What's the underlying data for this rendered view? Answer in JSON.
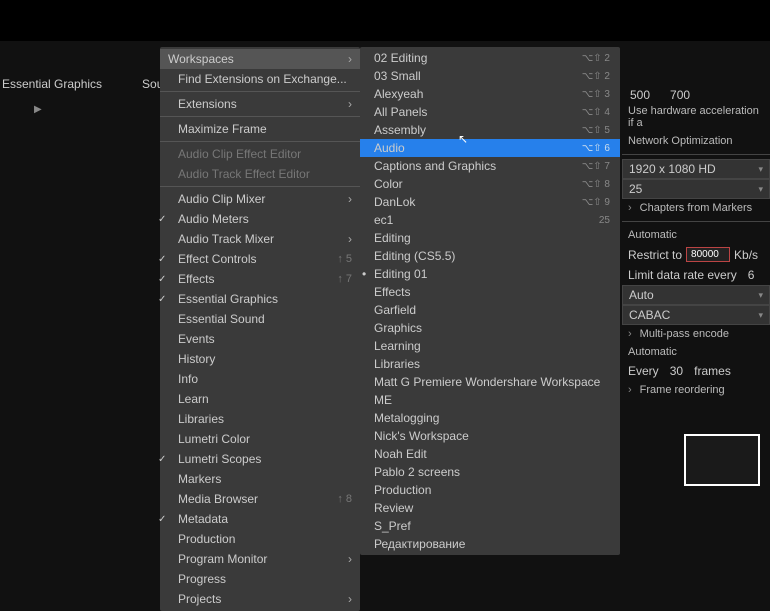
{
  "tabs": {
    "essential_graphics": "Essential Graphics",
    "source": "Source: (no cli"
  },
  "menu1": {
    "workspaces": "Workspaces",
    "find_ext": "Find Extensions on Exchange...",
    "extensions": "Extensions",
    "maximize": "Maximize Frame",
    "ace_editor": "Audio Clip Effect Editor",
    "ate_editor": "Audio Track Effect Editor",
    "items": [
      {
        "label": "Audio Clip Mixer",
        "chk": false,
        "arr": true,
        "sc": ""
      },
      {
        "label": "Audio Meters",
        "chk": true,
        "arr": false,
        "sc": ""
      },
      {
        "label": "Audio Track Mixer",
        "chk": false,
        "arr": true,
        "sc": ""
      },
      {
        "label": "Effect Controls",
        "chk": true,
        "arr": false,
        "sc": "↑ 5"
      },
      {
        "label": "Effects",
        "chk": true,
        "arr": false,
        "sc": "↑ 7"
      },
      {
        "label": "Essential Graphics",
        "chk": true,
        "arr": false,
        "sc": ""
      },
      {
        "label": "Essential Sound",
        "chk": false,
        "arr": false,
        "sc": ""
      },
      {
        "label": "Events",
        "chk": false,
        "arr": false,
        "sc": ""
      },
      {
        "label": "History",
        "chk": false,
        "arr": false,
        "sc": ""
      },
      {
        "label": "Info",
        "chk": false,
        "arr": false,
        "sc": ""
      },
      {
        "label": "Learn",
        "chk": false,
        "arr": false,
        "sc": ""
      },
      {
        "label": "Libraries",
        "chk": false,
        "arr": false,
        "sc": ""
      },
      {
        "label": "Lumetri Color",
        "chk": false,
        "arr": false,
        "sc": ""
      },
      {
        "label": "Lumetri Scopes",
        "chk": true,
        "arr": false,
        "sc": ""
      },
      {
        "label": "Markers",
        "chk": false,
        "arr": false,
        "sc": ""
      },
      {
        "label": "Media Browser",
        "chk": false,
        "arr": false,
        "sc": "↑ 8"
      },
      {
        "label": "Metadata",
        "chk": true,
        "arr": false,
        "sc": ""
      },
      {
        "label": "Production",
        "chk": false,
        "arr": false,
        "sc": ""
      },
      {
        "label": "Program Monitor",
        "chk": false,
        "arr": true,
        "sc": ""
      },
      {
        "label": "Progress",
        "chk": false,
        "arr": false,
        "sc": ""
      },
      {
        "label": "Projects",
        "chk": false,
        "arr": true,
        "sc": ""
      }
    ]
  },
  "menu2": {
    "items": [
      {
        "label": "02 Editing",
        "sc": "⌥⇧ 2",
        "hl": false,
        "dot": false
      },
      {
        "label": "03 Small",
        "sc": "⌥⇧ 2",
        "hl": false,
        "dot": false
      },
      {
        "label": "Alexyeah",
        "sc": "⌥⇧ 3",
        "hl": false,
        "dot": false
      },
      {
        "label": "All Panels",
        "sc": "⌥⇧ 4",
        "hl": false,
        "dot": false
      },
      {
        "label": "Assembly",
        "sc": "⌥⇧ 5",
        "hl": false,
        "dot": false
      },
      {
        "label": "Audio",
        "sc": "⌥⇧ 6",
        "hl": true,
        "dot": false
      },
      {
        "label": "Captions and Graphics",
        "sc": "⌥⇧ 7",
        "hl": false,
        "dot": false
      },
      {
        "label": "Color",
        "sc": "⌥⇧ 8",
        "hl": false,
        "dot": false
      },
      {
        "label": "DanLok",
        "sc": "⌥⇧ 9",
        "hl": false,
        "dot": false
      },
      {
        "label": "ec1",
        "sc": "25",
        "hl": false,
        "dot": false
      },
      {
        "label": "Editing",
        "sc": "",
        "hl": false,
        "dot": false
      },
      {
        "label": "Editing (CS5.5)",
        "sc": "",
        "hl": false,
        "dot": false
      },
      {
        "label": "Editing 01",
        "sc": "",
        "hl": false,
        "dot": true
      },
      {
        "label": "Effects",
        "sc": "",
        "hl": false,
        "dot": false
      },
      {
        "label": "Garfield",
        "sc": "",
        "hl": false,
        "dot": false
      },
      {
        "label": "Graphics",
        "sc": "",
        "hl": false,
        "dot": false
      },
      {
        "label": "Learning",
        "sc": "",
        "hl": false,
        "dot": false
      },
      {
        "label": "Libraries",
        "sc": "",
        "hl": false,
        "dot": false
      },
      {
        "label": "Matt G Premiere Wondershare Workspace",
        "sc": "",
        "hl": false,
        "dot": false
      },
      {
        "label": "ME",
        "sc": "",
        "hl": false,
        "dot": false
      },
      {
        "label": "Metalogging",
        "sc": "",
        "hl": false,
        "dot": false
      },
      {
        "label": "Nick's Workspace",
        "sc": "",
        "hl": false,
        "dot": false
      },
      {
        "label": "Noah Edit",
        "sc": "",
        "hl": false,
        "dot": false
      },
      {
        "label": "Pablo 2 screens",
        "sc": "",
        "hl": false,
        "dot": false
      },
      {
        "label": "Production",
        "sc": "",
        "hl": false,
        "dot": false
      },
      {
        "label": "Review",
        "sc": "",
        "hl": false,
        "dot": false
      },
      {
        "label": "S_Pref",
        "sc": "",
        "hl": false,
        "dot": false
      },
      {
        "label": "Редактирование",
        "sc": "",
        "hl": false,
        "dot": false
      }
    ]
  },
  "right": {
    "ruler": [
      "500",
      "700"
    ],
    "hw_accel": "Use hardware acceleration if a",
    "net_opt": "Network Optimization",
    "res": "1920 x 1080 HD",
    "chapters": "Chapters from Markers",
    "automatic": "Automatic",
    "restrict": "Restrict to",
    "restrict_val": "80000",
    "kbs": "Kb/s",
    "limit": "Limit data rate every",
    "limit_val": "6",
    "auto": "Auto",
    "cabac": "CABAC",
    "multipass": "Multi-pass encode",
    "automatic2": "Automatic",
    "every": "Every",
    "frames_val": "30",
    "frames": "frames",
    "reorder": "Frame reordering"
  }
}
